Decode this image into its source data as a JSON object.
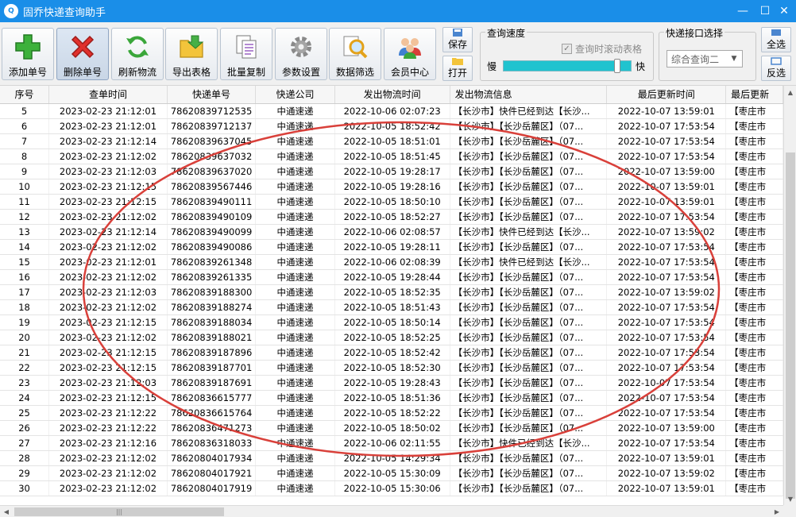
{
  "window": {
    "icon_text": "Q",
    "title": "固乔快递查询助手",
    "min": "—",
    "max": "☐",
    "close": "✕"
  },
  "toolbar": {
    "buttons": [
      {
        "label": "添加单号",
        "icon": "plus-icon"
      },
      {
        "label": "删除单号",
        "icon": "delete-x-icon"
      },
      {
        "label": "刷新物流",
        "icon": "refresh-icon"
      },
      {
        "label": "导出表格",
        "icon": "export-folder-icon"
      },
      {
        "label": "批量复制",
        "icon": "copy-icon"
      },
      {
        "label": "参数设置",
        "icon": "gear-icon"
      },
      {
        "label": "数据筛选",
        "icon": "magnifier-icon"
      },
      {
        "label": "会员中心",
        "icon": "members-icon"
      }
    ],
    "save": "保存",
    "open": "打开",
    "speed_group": {
      "title": "查询速度",
      "scroll_checkbox": "查询时滚动表格",
      "scroll_checked": true,
      "slow": "慢",
      "fast": "快",
      "speed_level": 0.9
    },
    "api_group": {
      "title": "快递接口选择",
      "selected": "综合查询二"
    },
    "select_all": "全选",
    "invert": "反选"
  },
  "table": {
    "columns": [
      "序号",
      "查单时间",
      "快递单号",
      "快递公司",
      "发出物流时间",
      "发出物流信息",
      "最后更新时间",
      "最后更新"
    ],
    "rows": [
      [
        "5",
        "2023-02-23  21:12:01",
        "78620839712535",
        "中通速递",
        "2022-10-06 02:07:23",
        "【长沙市】快件已经到达【长沙...",
        "2022-10-07 13:59:01",
        "【枣庄市"
      ],
      [
        "6",
        "2023-02-23  21:12:01",
        "78620839712137",
        "中通速递",
        "2022-10-05 18:52:42",
        "【长沙市】【长沙岳麓区】（07...",
        "2022-10-07 17:53:54",
        "【枣庄市"
      ],
      [
        "7",
        "2023-02-23  21:12:14",
        "78620839637045",
        "中通速递",
        "2022-10-05 18:51:01",
        "【长沙市】【长沙岳麓区】（07...",
        "2022-10-07 17:53:54",
        "【枣庄市"
      ],
      [
        "8",
        "2023-02-23  21:12:02",
        "78620839637032",
        "中通速递",
        "2022-10-05 18:51:45",
        "【长沙市】【长沙岳麓区】（07...",
        "2022-10-07 17:53:54",
        "【枣庄市"
      ],
      [
        "9",
        "2023-02-23  21:12:03",
        "78620839637020",
        "中通速递",
        "2022-10-05 19:28:17",
        "【长沙市】【长沙岳麓区】（07...",
        "2022-10-07 13:59:00",
        "【枣庄市"
      ],
      [
        "10",
        "2023-02-23  21:12:15",
        "78620839567446",
        "中通速递",
        "2022-10-05 19:28:16",
        "【长沙市】【长沙岳麓区】（07...",
        "2022-10-07 13:59:01",
        "【枣庄市"
      ],
      [
        "11",
        "2023-02-23  21:12:15",
        "78620839490111",
        "中通速递",
        "2022-10-05 18:50:10",
        "【长沙市】【长沙岳麓区】（07...",
        "2022-10-07 13:59:01",
        "【枣庄市"
      ],
      [
        "12",
        "2023-02-23  21:12:02",
        "78620839490109",
        "中通速递",
        "2022-10-05 18:52:27",
        "【长沙市】【长沙岳麓区】（07...",
        "2022-10-07 17:53:54",
        "【枣庄市"
      ],
      [
        "13",
        "2023-02-23  21:12:14",
        "78620839490099",
        "中通速递",
        "2022-10-06 02:08:57",
        "【长沙市】快件已经到达【长沙...",
        "2022-10-07 13:59:02",
        "【枣庄市"
      ],
      [
        "14",
        "2023-02-23  21:12:02",
        "78620839490086",
        "中通速递",
        "2022-10-05 19:28:11",
        "【长沙市】【长沙岳麓区】（07...",
        "2022-10-07 17:53:54",
        "【枣庄市"
      ],
      [
        "15",
        "2023-02-23  21:12:01",
        "78620839261348",
        "中通速递",
        "2022-10-06 02:08:39",
        "【长沙市】快件已经到达【长沙...",
        "2022-10-07 17:53:54",
        "【枣庄市"
      ],
      [
        "16",
        "2023-02-23  21:12:02",
        "78620839261335",
        "中通速递",
        "2022-10-05 19:28:44",
        "【长沙市】【长沙岳麓区】（07...",
        "2022-10-07 17:53:54",
        "【枣庄市"
      ],
      [
        "17",
        "2023-02-23  21:12:03",
        "78620839188300",
        "中通速递",
        "2022-10-05 18:52:35",
        "【长沙市】【长沙岳麓区】（07...",
        "2022-10-07 13:59:02",
        "【枣庄市"
      ],
      [
        "18",
        "2023-02-23  21:12:02",
        "78620839188274",
        "中通速递",
        "2022-10-05 18:51:43",
        "【长沙市】【长沙岳麓区】（07...",
        "2022-10-07 17:53:54",
        "【枣庄市"
      ],
      [
        "19",
        "2023-02-23  21:12:15",
        "78620839188034",
        "中通速递",
        "2022-10-05 18:50:14",
        "【长沙市】【长沙岳麓区】（07...",
        "2022-10-07 17:53:54",
        "【枣庄市"
      ],
      [
        "20",
        "2023-02-23  21:12:02",
        "78620839188021",
        "中通速递",
        "2022-10-05 18:52:25",
        "【长沙市】【长沙岳麓区】（07...",
        "2022-10-07 17:53:54",
        "【枣庄市"
      ],
      [
        "21",
        "2023-02-23  21:12:15",
        "78620839187896",
        "中通速递",
        "2022-10-05 18:52:42",
        "【长沙市】【长沙岳麓区】（07...",
        "2022-10-07 17:53:54",
        "【枣庄市"
      ],
      [
        "22",
        "2023-02-23  21:12:15",
        "78620839187701",
        "中通速递",
        "2022-10-05 18:52:30",
        "【长沙市】【长沙岳麓区】（07...",
        "2022-10-07 17:53:54",
        "【枣庄市"
      ],
      [
        "23",
        "2023-02-23  21:12:03",
        "78620839187691",
        "中通速递",
        "2022-10-05 19:28:43",
        "【长沙市】【长沙岳麓区】（07...",
        "2022-10-07 17:53:54",
        "【枣庄市"
      ],
      [
        "24",
        "2023-02-23  21:12:15",
        "78620836615777",
        "中通速递",
        "2022-10-05 18:51:36",
        "【长沙市】【长沙岳麓区】（07...",
        "2022-10-07 17:53:54",
        "【枣庄市"
      ],
      [
        "25",
        "2023-02-23  21:12:22",
        "78620836615764",
        "中通速递",
        "2022-10-05 18:52:22",
        "【长沙市】【长沙岳麓区】（07...",
        "2022-10-07 17:53:54",
        "【枣庄市"
      ],
      [
        "26",
        "2023-02-23  21:12:22",
        "78620836471273",
        "中通速递",
        "2022-10-05 18:50:02",
        "【长沙市】【长沙岳麓区】（07...",
        "2022-10-07 13:59:00",
        "【枣庄市"
      ],
      [
        "27",
        "2023-02-23  21:12:16",
        "78620836318033",
        "中通速递",
        "2022-10-06 02:11:55",
        "【长沙市】快件已经到达【长沙...",
        "2022-10-07 17:53:54",
        "【枣庄市"
      ],
      [
        "28",
        "2023-02-23  21:12:02",
        "78620804017934",
        "中通速递",
        "2022-10-05 14:29:34",
        "【长沙市】【长沙岳麓区】（07...",
        "2022-10-07 13:59:01",
        "【枣庄市"
      ],
      [
        "29",
        "2023-02-23  21:12:02",
        "78620804017921",
        "中通速递",
        "2022-10-05 15:30:09",
        "【长沙市】【长沙岳麓区】（07...",
        "2022-10-07 13:59:02",
        "【枣庄市"
      ],
      [
        "30",
        "2023-02-23  21:12:02",
        "78620804017919",
        "中通速递",
        "2022-10-05 15:30:06",
        "【长沙市】【长沙岳麓区】（07...",
        "2022-10-07 13:59:01",
        "【枣庄市"
      ]
    ]
  },
  "scrollbars": {
    "up": "▲",
    "down": "▼",
    "left": "◀",
    "right": "▶",
    "grip": "|||"
  },
  "colors": {
    "titlebar": "#1a8ee8",
    "annotation": "#d9403a",
    "speed_fill": "#20c3cf"
  }
}
